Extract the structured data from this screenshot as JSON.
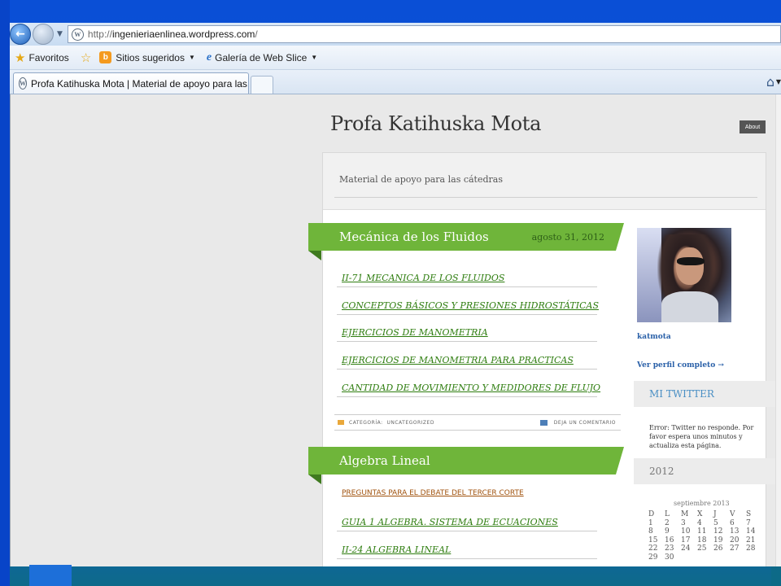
{
  "browser": {
    "url_prefix": "http://",
    "url_domain": "ingenieriaenlinea.wordpress.com",
    "url_suffix": "/",
    "favorites_label": "Favoritos",
    "suggested_label": "Sitios sugeridos",
    "webslice_label": "Galería de Web Slice",
    "tab_title": "Profa Katihuska Mota | Material de apoyo para las..."
  },
  "site": {
    "title": "Profa Katihuska Mota",
    "about_label": "About",
    "description": "Material de apoyo para las cátedras"
  },
  "posts": [
    {
      "title": "Mecánica de los Fluidos",
      "date": "agosto 31, 2012",
      "links": [
        "II-71 MECANICA DE LOS FLUIDOS",
        "CONCEPTOS BÁSICOS Y PRESIONES HIDROSTÁTICAS",
        "EJERCICIOS DE MANOMETRIA",
        "EJERCICIOS DE MANOMETRIA PARA PRACTICAS",
        "CANTIDAD DE MOVIMIENTO Y MEDIDORES DE FLUJO"
      ],
      "category_label": "CATEGORÍA:",
      "category_value": "UNCATEGORIZED",
      "comment_label": "DEJA UN COMENTARIO"
    },
    {
      "title": "Algebra Lineal",
      "links": [
        "PREGUNTAS PARA EL DEBATE DEL TERCER CORTE",
        "GUIA 1 ALGEBRA. SISTEMA DE ECUACIONES",
        "II-24 ALGEBRA LINEAL"
      ]
    }
  ],
  "sidebar": {
    "username": "katmota",
    "profile_link": "Ver perfil completo →",
    "twitter_heading": "MI TWITTER",
    "twitter_message": "Error: Twitter no responde. Por favor espera unos minutos y actualiza esta página.",
    "archive_heading": "2012",
    "calendar_title": "septiembre 2013",
    "calendar_days": [
      "D",
      "L",
      "M",
      "X",
      "J",
      "V",
      "S"
    ],
    "calendar_rows": [
      [
        "1",
        "2",
        "3",
        "4",
        "5",
        "6",
        "7"
      ],
      [
        "8",
        "9",
        "10",
        "11",
        "12",
        "13",
        "14"
      ],
      [
        "15",
        "16",
        "17",
        "18",
        "19",
        "20",
        "21"
      ],
      [
        "22",
        "23",
        "24",
        "25",
        "26",
        "27",
        "28"
      ],
      [
        "29",
        "30",
        "",
        "",
        "",
        "",
        ""
      ]
    ]
  },
  "colors": {
    "ribbon_green": "#6fb53a",
    "link_green": "#2e7d0f",
    "sidebar_blue": "#2a60a8"
  }
}
